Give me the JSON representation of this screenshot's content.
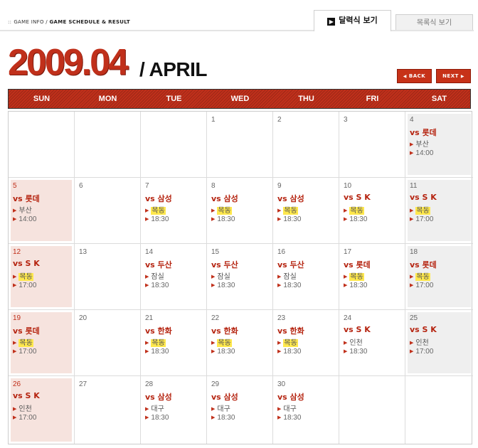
{
  "header": {
    "breadcrumb_root": "GAME INFO",
    "breadcrumb_current": "GAME SCHEDULE & RESULT",
    "tabs": [
      {
        "label": "달력식 보기",
        "active": true
      },
      {
        "label": "목록식 보기",
        "active": false
      }
    ]
  },
  "title": {
    "year_month": "2009.04",
    "month_name": "/ APRIL"
  },
  "nav": {
    "back": "BACK",
    "next": "NEXT"
  },
  "weekdays": [
    "SUN",
    "MON",
    "TUE",
    "WED",
    "THU",
    "FRI",
    "SAT"
  ],
  "colors": {
    "accent": "#c0301b",
    "sunday_bg": "#f6e3de",
    "saturday_bg": "#efefef",
    "home_highlight": "#ffe84d"
  },
  "weeks": [
    [
      {
        "day": ""
      },
      {
        "day": ""
      },
      {
        "day": ""
      },
      {
        "day": "1"
      },
      {
        "day": "2"
      },
      {
        "day": "3"
      },
      {
        "day": "4",
        "opponent": "vs 롯데",
        "venue": "부산",
        "time": "14:00"
      }
    ],
    [
      {
        "day": "5",
        "opponent": "vs 롯데",
        "venue": "부산",
        "time": "14:00"
      },
      {
        "day": "6"
      },
      {
        "day": "7",
        "opponent": "vs 삼성",
        "venue": "목동",
        "home": true,
        "time": "18:30"
      },
      {
        "day": "8",
        "opponent": "vs 삼성",
        "venue": "목동",
        "home": true,
        "time": "18:30"
      },
      {
        "day": "9",
        "opponent": "vs 삼성",
        "venue": "목동",
        "home": true,
        "time": "18:30"
      },
      {
        "day": "10",
        "opponent": "vs S K",
        "venue": "목동",
        "home": true,
        "time": "18:30"
      },
      {
        "day": "11",
        "opponent": "vs S K",
        "venue": "목동",
        "home": true,
        "time": "17:00"
      }
    ],
    [
      {
        "day": "12",
        "opponent": "vs S K",
        "venue": "목동",
        "home": true,
        "time": "17:00"
      },
      {
        "day": "13"
      },
      {
        "day": "14",
        "opponent": "vs 두산",
        "venue": "잠실",
        "time": "18:30"
      },
      {
        "day": "15",
        "opponent": "vs 두산",
        "venue": "잠실",
        "time": "18:30"
      },
      {
        "day": "16",
        "opponent": "vs 두산",
        "venue": "잠실",
        "time": "18:30"
      },
      {
        "day": "17",
        "opponent": "vs 롯데",
        "venue": "목동",
        "home": true,
        "time": "18:30"
      },
      {
        "day": "18",
        "opponent": "vs 롯데",
        "venue": "목동",
        "home": true,
        "time": "17:00"
      }
    ],
    [
      {
        "day": "19",
        "opponent": "vs 롯데",
        "venue": "목동",
        "home": true,
        "time": "17:00"
      },
      {
        "day": "20"
      },
      {
        "day": "21",
        "opponent": "vs 한화",
        "venue": "목동",
        "home": true,
        "time": "18:30"
      },
      {
        "day": "22",
        "opponent": "vs 한화",
        "venue": "목동",
        "home": true,
        "time": "18:30"
      },
      {
        "day": "23",
        "opponent": "vs 한화",
        "venue": "목동",
        "home": true,
        "time": "18:30"
      },
      {
        "day": "24",
        "opponent": "vs S K",
        "venue": "인천",
        "time": "18:30"
      },
      {
        "day": "25",
        "opponent": "vs S K",
        "venue": "인천",
        "time": "17:00"
      }
    ],
    [
      {
        "day": "26",
        "opponent": "vs S K",
        "venue": "인천",
        "time": "17:00"
      },
      {
        "day": "27"
      },
      {
        "day": "28",
        "opponent": "vs 삼성",
        "venue": "대구",
        "time": "18:30"
      },
      {
        "day": "29",
        "opponent": "vs 삼성",
        "venue": "대구",
        "time": "18:30"
      },
      {
        "day": "30",
        "opponent": "vs 삼성",
        "venue": "대구",
        "time": "18:30"
      },
      {
        "day": ""
      },
      {
        "day": ""
      }
    ]
  ]
}
